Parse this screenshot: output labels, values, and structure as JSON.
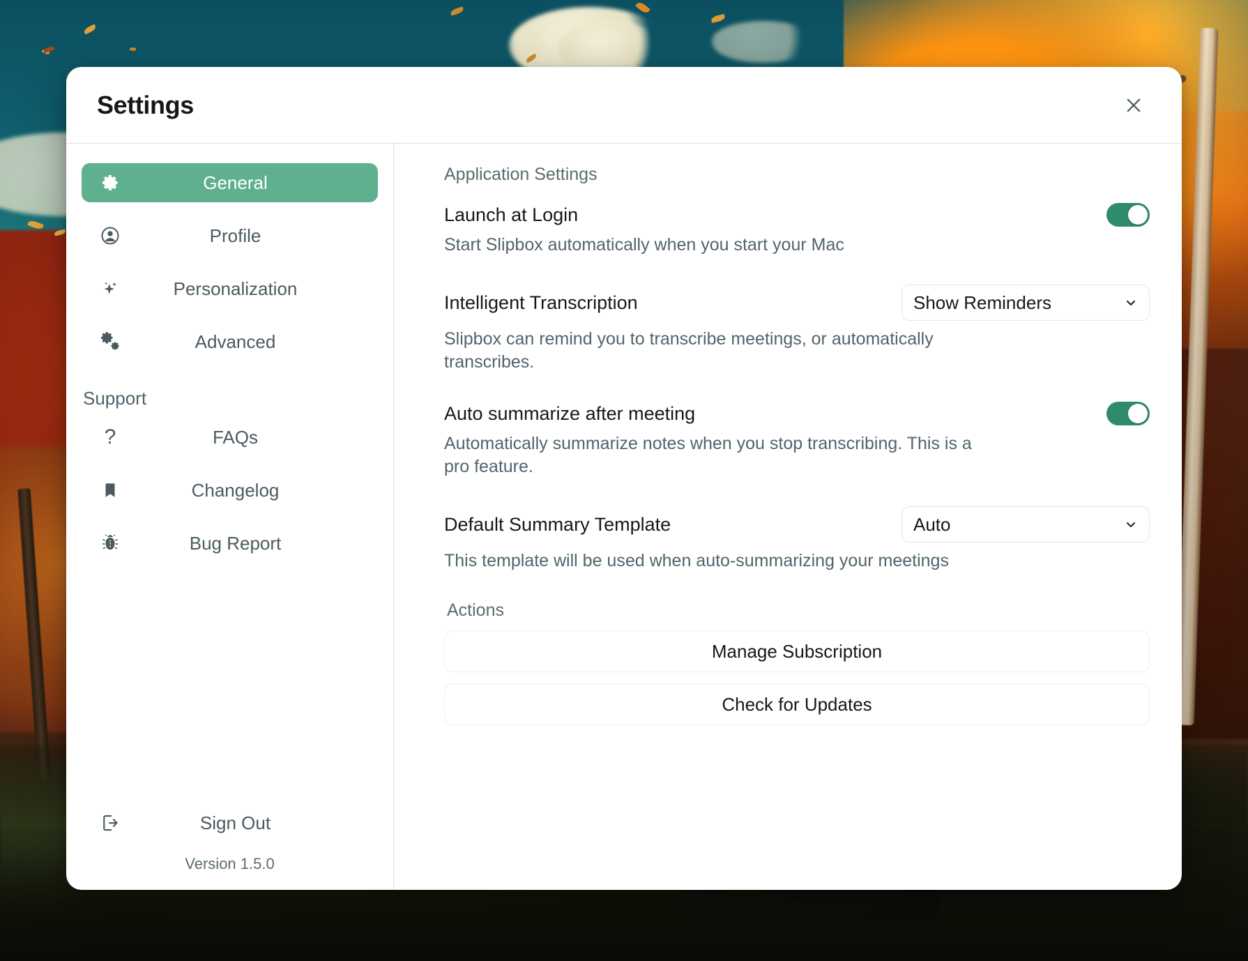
{
  "window": {
    "title": "Settings",
    "close_label": "×",
    "version": "Version 1.5.0"
  },
  "sidebar": {
    "items": [
      {
        "label": "General",
        "icon": "gear-icon",
        "active": true
      },
      {
        "label": "Profile",
        "icon": "person-circle-icon",
        "active": false
      },
      {
        "label": "Personalization",
        "icon": "sparkle-icon",
        "active": false
      },
      {
        "label": "Advanced",
        "icon": "double-gear-icon",
        "active": false
      }
    ],
    "support_label": "Support",
    "support_items": [
      {
        "label": "FAQs",
        "icon": "question-mark-icon"
      },
      {
        "label": "Changelog",
        "icon": "bookmark-icon"
      },
      {
        "label": "Bug Report",
        "icon": "bug-icon"
      }
    ],
    "sign_out": {
      "label": "Sign Out",
      "icon": "sign-out-icon"
    }
  },
  "main": {
    "group_heading": "Application Settings",
    "launch_at_login": {
      "title": "Launch at Login",
      "description": "Start Slipbox automatically when you start your Mac",
      "enabled": true
    },
    "intelligent_transcription": {
      "title": "Intelligent Transcription",
      "description": "Slipbox can remind you to transcribe meetings, or automatically transcribes.",
      "value": "Show Reminders"
    },
    "auto_summarize": {
      "title": "Auto summarize after meeting",
      "description": "Automatically summarize notes when you stop transcribing. This is a pro feature.",
      "enabled": true
    },
    "default_summary_template": {
      "title": "Default Summary Template",
      "description": "This template will be used when auto-summarizing your meetings",
      "value": "Auto"
    },
    "actions_heading": "Actions",
    "actions": [
      {
        "label": "Manage Subscription"
      },
      {
        "label": "Check for Updates"
      }
    ]
  },
  "colors": {
    "accent_green": "#5fb08e",
    "toggle_green": "#2e8b6e",
    "text_primary": "#15171a",
    "text_secondary": "#51646c"
  }
}
